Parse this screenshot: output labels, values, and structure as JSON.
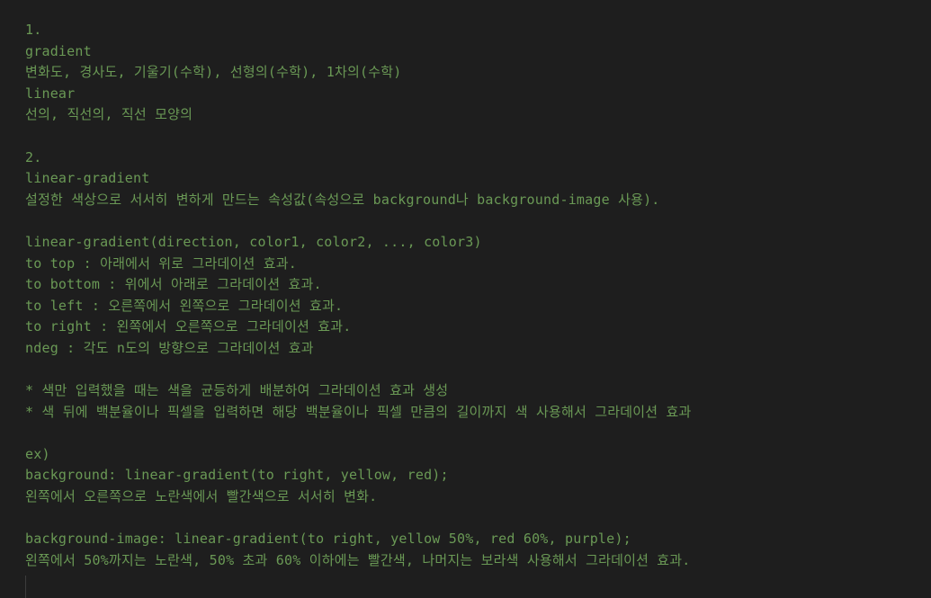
{
  "editor": {
    "lines": [
      "1.",
      "gradient",
      "변화도, 경사도, 기울기(수학), 선형의(수학), 1차의(수학)",
      "linear",
      "선의, 직선의, 직선 모양의",
      "",
      "2.",
      "linear-gradient",
      "설정한 색상으로 서서히 변하게 만드는 속성값(속성으로 background나 background-image 사용).",
      "",
      "linear-gradient(direction, color1, color2, ..., color3)",
      "to top : 아래에서 위로 그라데이션 효과.",
      "to bottom : 위에서 아래로 그라데이션 효과.",
      "to left : 오른쪽에서 왼쪽으로 그라데이션 효과.",
      "to right : 왼쪽에서 오른쪽으로 그라데이션 효과.",
      "ndeg : 각도 n도의 방향으로 그라데이션 효과",
      "",
      "* 색만 입력했을 때는 색을 균등하게 배분하여 그라데이션 효과 생성",
      "* 색 뒤에 백분율이나 픽셀을 입력하면 해당 백분율이나 픽셀 만큼의 길이까지 색 사용해서 그라데이션 효과",
      "",
      "ex)",
      "background: linear-gradient(to right, yellow, red);",
      "왼쪽에서 오른쪽으로 노란색에서 빨간색으로 서서히 변화.",
      "",
      "background-image: linear-gradient(to right, yellow 50%, red 60%, purple);",
      "왼쪽에서 50%까지는 노란색, 50% 초과 60% 이하에는 빨간색, 나머지는 보라색 사용해서 그라데이션 효과."
    ]
  },
  "colors": {
    "background": "#1e1e1e",
    "comment_text": "#6a9955"
  }
}
